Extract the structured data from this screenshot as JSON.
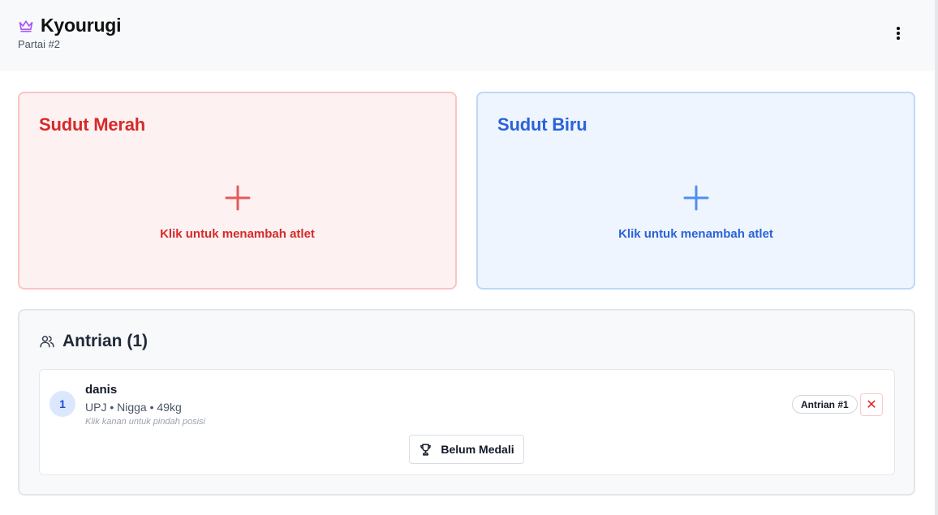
{
  "header": {
    "title": "Kyourugi",
    "subtitle": "Partai #2",
    "crown_color": "#a855f7"
  },
  "corners": {
    "red": {
      "title": "Sudut Merah",
      "hint": "Klik untuk menambah atlet",
      "accent": "#d62a2a"
    },
    "blue": {
      "title": "Sudut Biru",
      "hint": "Klik untuk menambah atlet",
      "accent": "#2b63d8"
    }
  },
  "queue": {
    "title": "Antrian (1)",
    "entries": [
      {
        "number": "1",
        "name": "danis",
        "meta": "UPJ • Nigga • 49kg",
        "hint": "Klik kanan untuk pindah posisi",
        "badge": "Antrian #1",
        "remove_label": "✕",
        "medal_label": "Belum Medali"
      }
    ]
  }
}
